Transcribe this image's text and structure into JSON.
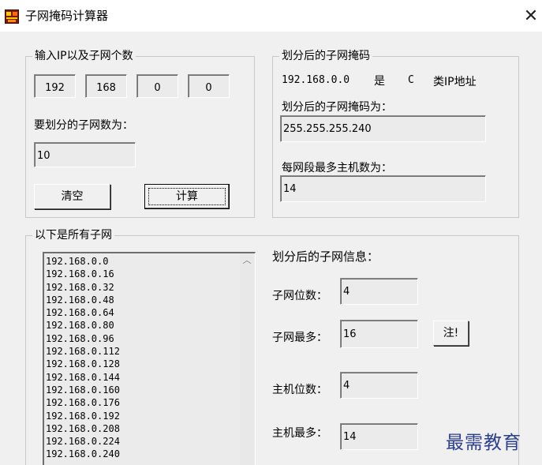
{
  "window": {
    "title": "子网掩码计算器",
    "close_glyph": "✕"
  },
  "input_group": {
    "legend": "输入IP以及子网个数",
    "ip_octets": [
      "192",
      "168",
      "0",
      "0"
    ],
    "subnet_count_label": "要划分的子网数为：",
    "subnet_count_value": "10",
    "clear_label": "清空",
    "calc_label": "计算"
  },
  "mask_group": {
    "legend": "划分后的子网掩码",
    "ip_text": "192.168.0.0",
    "is_text": "是",
    "class_letter": "C",
    "class_suffix": "类IP地址",
    "mask_label": "划分后的子网掩码为：",
    "mask_value": "255.255.255.240",
    "hosts_label": "每网段最多主机数为：",
    "hosts_value": "14"
  },
  "subnets_group": {
    "legend": "以下是所有子网",
    "subnets": [
      "192.168.0.0",
      "192.168.0.16",
      "192.168.0.32",
      "192.168.0.48",
      "192.168.0.64",
      "192.168.0.80",
      "192.168.0.96",
      "192.168.0.112",
      "192.168.0.128",
      "192.168.0.144",
      "192.168.0.160",
      "192.168.0.176",
      "192.168.0.192",
      "192.168.0.208",
      "192.168.0.224",
      "192.168.0.240"
    ],
    "scroll_up_glyph": "︿",
    "info_heading": "划分后的子网信息：",
    "subnet_bits_label": "子网位数：",
    "subnet_bits_value": "4",
    "subnet_max_label": "子网最多：",
    "subnet_max_value": "16",
    "note_label": "注!",
    "host_bits_label": "主机位数：",
    "host_bits_value": "4",
    "host_max_label": "主机最多：",
    "host_max_value": "14"
  },
  "watermark": "最需教育"
}
